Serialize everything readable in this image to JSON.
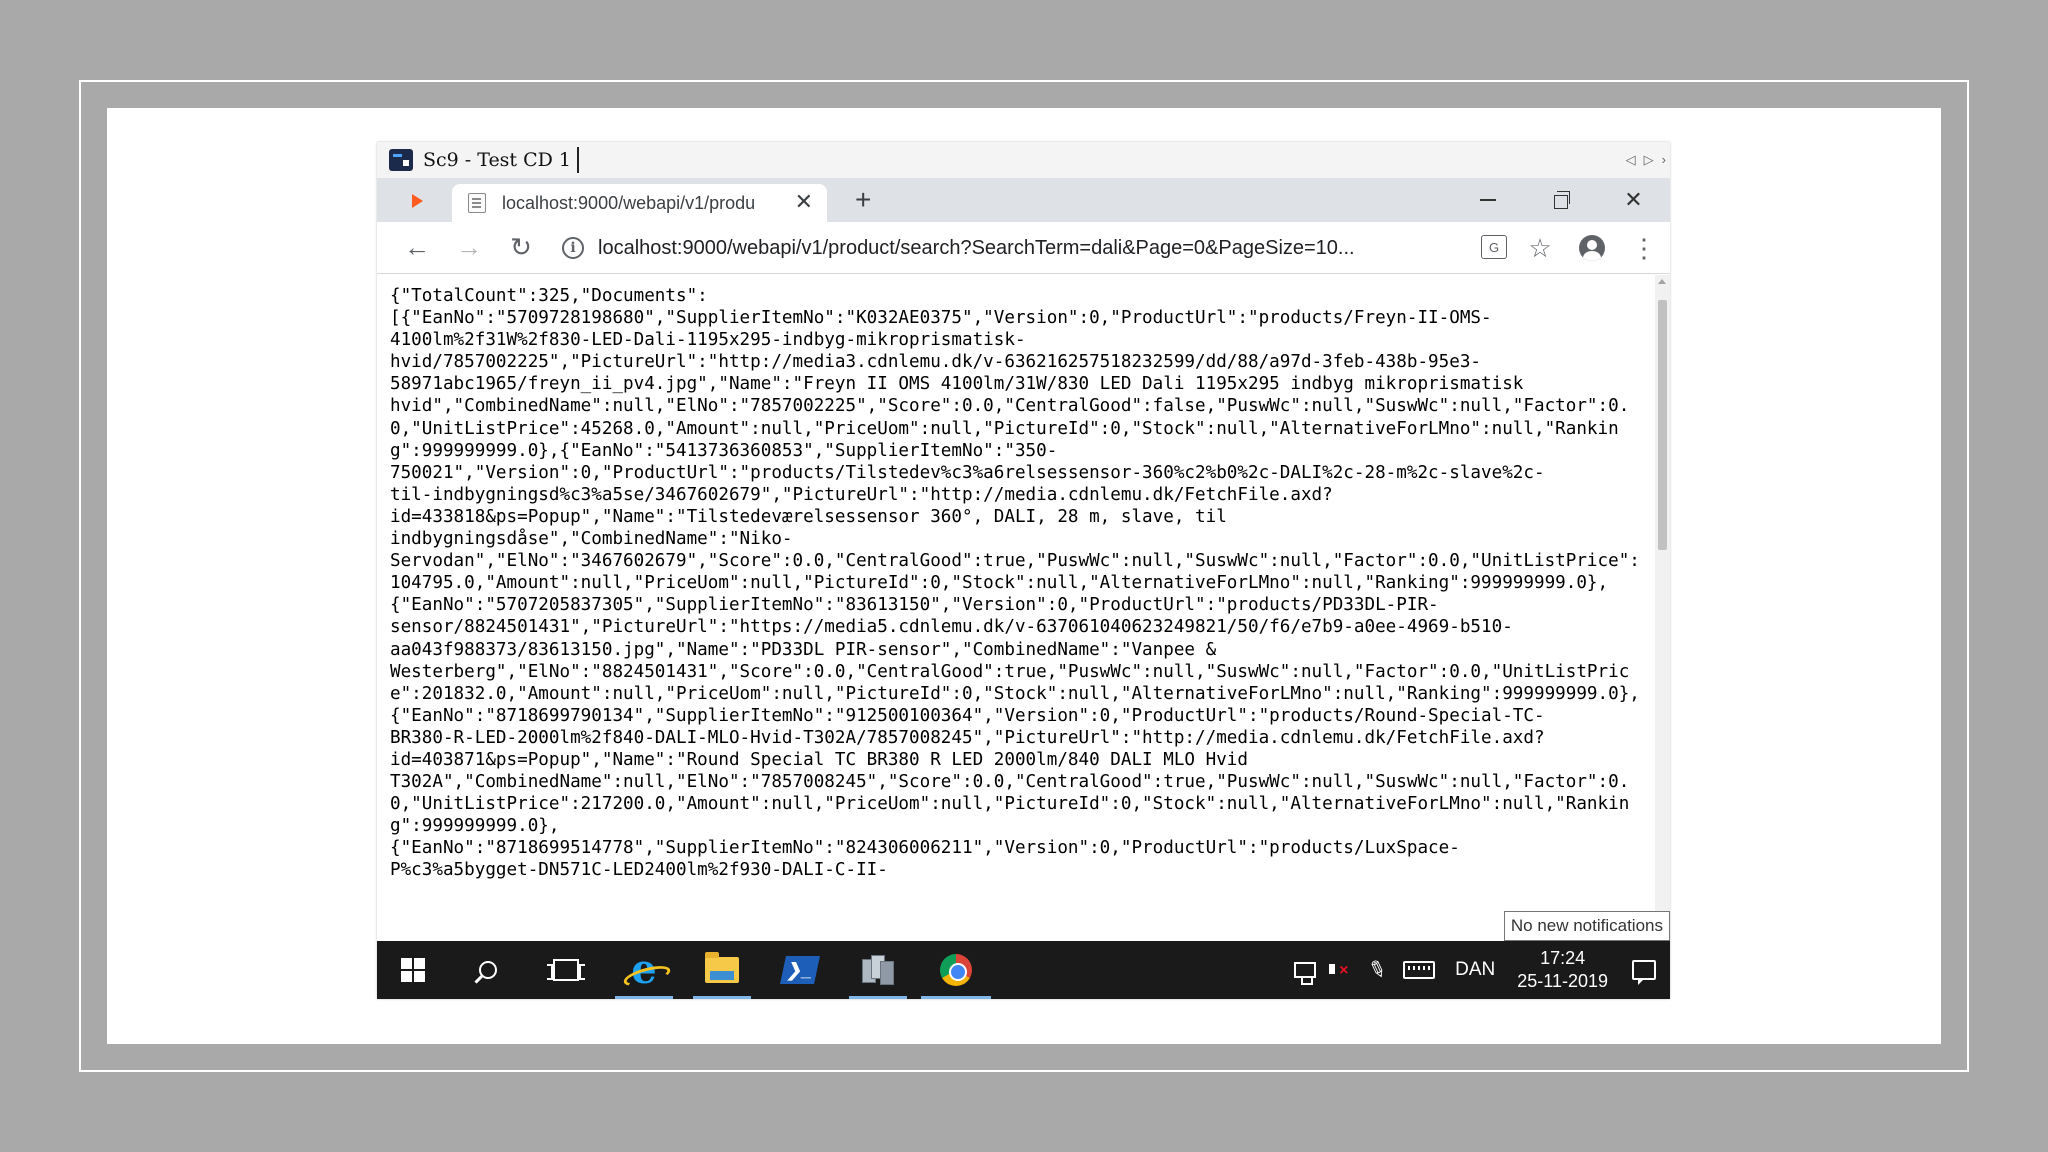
{
  "session": {
    "title": "Sc9 - Test CD 1",
    "nav_left": "◁",
    "nav_right": "▷",
    "nav_more": "›"
  },
  "browser": {
    "tab_title": "localhost:9000/webapi/v1/produ",
    "tab_close": "✕",
    "new_tab": "+",
    "close_window": "✕",
    "back": "←",
    "forward": "→",
    "reload": "↻",
    "info": "i",
    "url": "localhost:9000/webapi/v1/product/search?SearchTerm=dali&Page=0&PageSize=10...",
    "translate": "G",
    "star": "☆",
    "menu": "⋮"
  },
  "content": {
    "json_text": "{\"TotalCount\":325,\"Documents\":\n[{\"EanNo\":\"5709728198680\",\"SupplierItemNo\":\"K032AE0375\",\"Version\":0,\"ProductUrl\":\"products/Freyn-II-OMS-\n4100lm%2f31W%2f830-LED-Dali-1195x295-indbyg-mikroprismatisk-\nhvid/7857002225\",\"PictureUrl\":\"http://media3.cdnlemu.dk/v-636216257518232599/dd/88/a97d-3feb-438b-95e3-\n58971abc1965/freyn_ii_pv4.jpg\",\"Name\":\"Freyn II OMS 4100lm/31W/830 LED Dali 1195x295 indbyg mikroprismatisk\nhvid\",\"CombinedName\":null,\"ElNo\":\"7857002225\",\"Score\":0.0,\"CentralGood\":false,\"PuswWc\":null,\"SuswWc\":null,\"Factor\":0.0,\"UnitListPrice\":45268.0,\"Amount\":null,\"PriceUom\":null,\"PictureId\":0,\"Stock\":null,\"AlternativeForLMno\":null,\"Ranking\":999999999.0},{\"EanNo\":\"5413736360853\",\"SupplierItemNo\":\"350-\n750021\",\"Version\":0,\"ProductUrl\":\"products/Tilstedev%c3%a6relsessensor-360%c2%b0%2c-DALI%2c-28-m%2c-slave%2c-\ntil-indbygningsd%c3%a5se/3467602679\",\"PictureUrl\":\"http://media.cdnlemu.dk/FetchFile.axd?\nid=433818&ps=Popup\",\"Name\":\"Tilstedeværelsessensor 360°, DALI, 28 m, slave, til\nindbygningsdåse\",\"CombinedName\":\"Niko-\nServodan\",\"ElNo\":\"3467602679\",\"Score\":0.0,\"CentralGood\":true,\"PuswWc\":null,\"SuswWc\":null,\"Factor\":0.0,\"UnitListPrice\":104795.0,\"Amount\":null,\"PriceUom\":null,\"PictureId\":0,\"Stock\":null,\"AlternativeForLMno\":null,\"Ranking\":999999999.0},\n{\"EanNo\":\"5707205837305\",\"SupplierItemNo\":\"83613150\",\"Version\":0,\"ProductUrl\":\"products/PD33DL-PIR-\nsensor/8824501431\",\"PictureUrl\":\"https://media5.cdnlemu.dk/v-637061040623249821/50/f6/e7b9-a0ee-4969-b510-\naa043f988373/83613150.jpg\",\"Name\":\"PD33DL PIR-sensor\",\"CombinedName\":\"Vanpee &\nWesterberg\",\"ElNo\":\"8824501431\",\"Score\":0.0,\"CentralGood\":true,\"PuswWc\":null,\"SuswWc\":null,\"Factor\":0.0,\"UnitListPrice\":201832.0,\"Amount\":null,\"PriceUom\":null,\"PictureId\":0,\"Stock\":null,\"AlternativeForLMno\":null,\"Ranking\":999999999.0},\n{\"EanNo\":\"8718699790134\",\"SupplierItemNo\":\"912500100364\",\"Version\":0,\"ProductUrl\":\"products/Round-Special-TC-\nBR380-R-LED-2000lm%2f840-DALI-MLO-Hvid-T302A/7857008245\",\"PictureUrl\":\"http://media.cdnlemu.dk/FetchFile.axd?\nid=403871&ps=Popup\",\"Name\":\"Round Special TC BR380 R LED 2000lm/840 DALI MLO Hvid\nT302A\",\"CombinedName\":null,\"ElNo\":\"7857008245\",\"Score\":0.0,\"CentralGood\":true,\"PuswWc\":null,\"SuswWc\":null,\"Factor\":0.0,\"UnitListPrice\":217200.0,\"Amount\":null,\"PriceUom\":null,\"PictureId\":0,\"Stock\":null,\"AlternativeForLMno\":null,\"Ranking\":999999999.0},\n{\"EanNo\":\"8718699514778\",\"SupplierItemNo\":\"824306006211\",\"Version\":0,\"ProductUrl\":\"products/LuxSpace-\nP%c3%a5bygget-DN571C-LED2400lm%2f930-DALI-C-II-"
  },
  "notification": {
    "text": "No new notifications"
  },
  "taskbar": {
    "ps_symbol": "❯_",
    "pen_symbol": "✎",
    "language": "DAN",
    "time": "17:24",
    "date": "25-11-2019"
  }
}
